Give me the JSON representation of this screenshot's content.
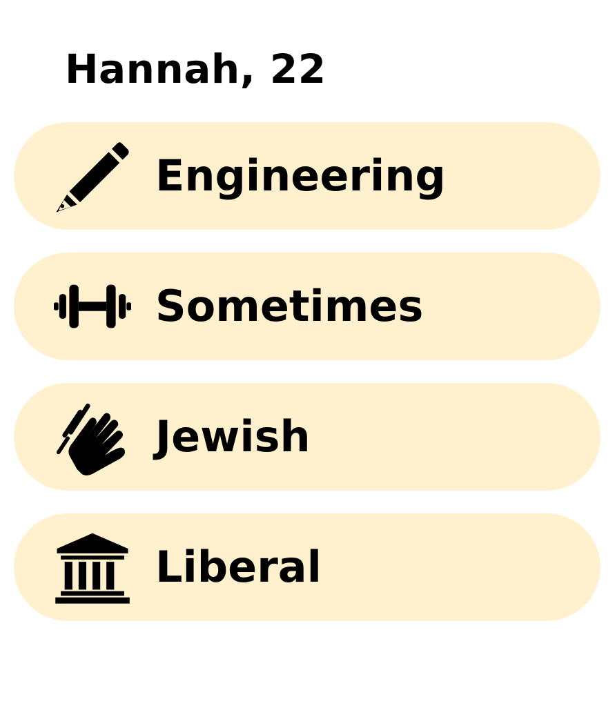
{
  "profile": {
    "name_age": "Hannah, 22"
  },
  "attributes": [
    {
      "icon": "pencil-icon",
      "label": "Engineering"
    },
    {
      "icon": "dumbbell-icon",
      "label": "Sometimes"
    },
    {
      "icon": "praying-hands-icon",
      "label": "Jewish"
    },
    {
      "icon": "government-building-icon",
      "label": "Liberal"
    }
  ],
  "colors": {
    "pill_background": "#fff1cd",
    "text": "#000000",
    "page_background": "#ffffff"
  }
}
